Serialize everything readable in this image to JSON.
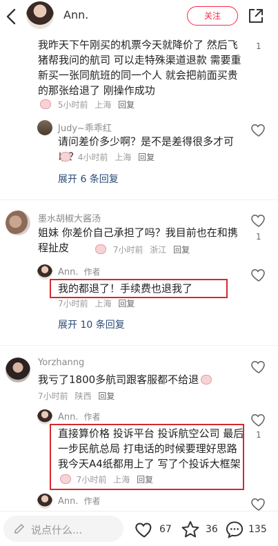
{
  "header": {
    "name": "Ann.",
    "follow_label": "关注"
  },
  "comments": {
    "c1": {
      "text": "我昨天下午刚买的机票今天就降价了 然后飞猪帮我问的航司 可以走特殊渠道退款 需要重新买一张同航班的同一个人 就会把前面买贵的那张给退了 刚操作成功",
      "time": "5小时前",
      "loc": "上海",
      "reply": "回复",
      "likes": "1"
    },
    "c1r1": {
      "user": "Judy~乖乖红",
      "text": "请问差价多少啊？是不是差得很多才可以？",
      "time": "4小时前",
      "loc": "上海",
      "reply": "回复"
    },
    "c1_expand": "展开 6 条回复",
    "c2": {
      "user": "墨水胡椒大酱汤",
      "text": "姐妹 你差价自己承担了吗？我目前也在和携程扯皮",
      "time": "7小时前",
      "loc": "浙江",
      "reply": "回复",
      "likes": "1"
    },
    "c2r1": {
      "user": "Ann.",
      "tag": "作者",
      "text": "我的都退了！手续费也退我了",
      "time": "7小时前",
      "loc": "上海",
      "reply": "回复"
    },
    "c2_expand": "展开 10 条回复",
    "c3": {
      "user": "Yorzhanng",
      "text": "我亏了1800多航司跟客服都不给退",
      "time": "7小时前",
      "loc": "陕西",
      "reply": "回复"
    },
    "c3r1": {
      "user": "Ann.",
      "tag": "作者",
      "text": "直接算价格 投诉平台 投诉航空公司 最后一步民航总局 打电话的时候要理好思路 我今天A4纸都用上了 写了个投诉大框架",
      "time": "7小时前",
      "loc": "上海",
      "reply": "回复",
      "likes": "1"
    },
    "c3r2": {
      "user": "Ann.",
      "tag": "作者"
    }
  },
  "bottom": {
    "placeholder": "说点什么...",
    "likes": "67",
    "stars": "36",
    "comments": "135"
  },
  "colors": {
    "accent": "#ff2442",
    "link": "#2a4b78",
    "highlight_box": "#d7262e"
  }
}
